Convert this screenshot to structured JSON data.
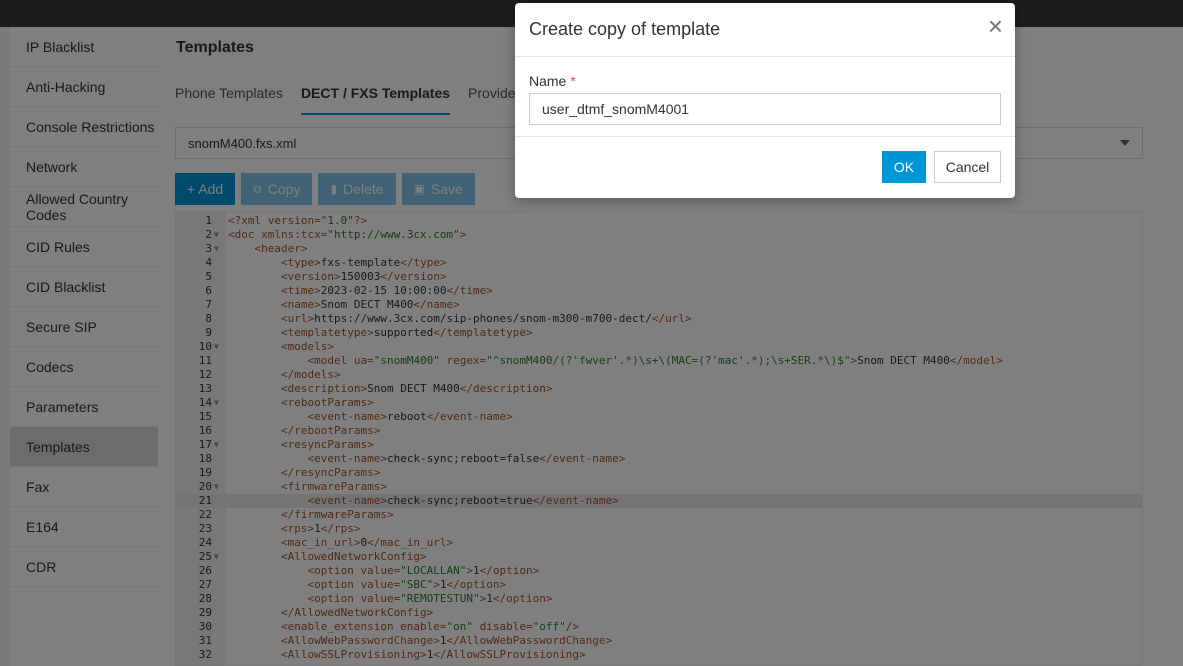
{
  "sidebar": {
    "items": [
      {
        "label": "IP Blacklist"
      },
      {
        "label": "Anti-Hacking"
      },
      {
        "label": "Console Restrictions"
      },
      {
        "label": "Network"
      },
      {
        "label": "Allowed Country Codes"
      },
      {
        "label": "CID Rules"
      },
      {
        "label": "CID Blacklist"
      },
      {
        "label": "Secure SIP"
      },
      {
        "label": "Codecs"
      },
      {
        "label": "Parameters"
      },
      {
        "label": "Templates"
      },
      {
        "label": "Fax"
      },
      {
        "label": "E164"
      },
      {
        "label": "CDR"
      }
    ]
  },
  "main": {
    "title": "Templates",
    "tabs": [
      "Phone Templates",
      "DECT / FXS Templates",
      "Provider T"
    ],
    "selected_template": "snomM400.fxs.xml",
    "toolbar": {
      "add": "+ Add",
      "copy": "Copy",
      "delete": "Delete",
      "save": "Save"
    }
  },
  "editor": {
    "lines": [
      {
        "n": "1",
        "c": "<?xml version=\"1.0\"?>"
      },
      {
        "n": "2",
        "c": "<doc xmlns:tcx=\"http://www.3cx.com\">"
      },
      {
        "n": "3",
        "c": "    <header>"
      },
      {
        "n": "4",
        "c": "        <type>fxs-template</type>"
      },
      {
        "n": "5",
        "c": "        <version>150003</version>"
      },
      {
        "n": "6",
        "c": "        <time>2023-02-15 10:00:00</time>"
      },
      {
        "n": "7",
        "c": "        <name>Snom DECT M400</name>"
      },
      {
        "n": "8",
        "c": "        <url>https://www.3cx.com/sip-phones/snom-m300-m700-dect/</url>"
      },
      {
        "n": "9",
        "c": "        <templatetype>supported</templatetype>"
      },
      {
        "n": "10",
        "c": "        <models>"
      },
      {
        "n": "11",
        "c": "            <model ua=\"snomM400\" regex=\"^snomM400/(?'fwver'.*)\\s+\\(MAC=(?'mac'.*);\\s+SER.*\\)$\">Snom DECT M400</model>"
      },
      {
        "n": "12",
        "c": "        </models>"
      },
      {
        "n": "13",
        "c": "        <description>Snom DECT M400</description>"
      },
      {
        "n": "14",
        "c": "        <rebootParams>"
      },
      {
        "n": "15",
        "c": "            <event-name>reboot</event-name>"
      },
      {
        "n": "16",
        "c": "        </rebootParams>"
      },
      {
        "n": "17",
        "c": "        <resyncParams>"
      },
      {
        "n": "18",
        "c": "            <event-name>check-sync;reboot=false</event-name>"
      },
      {
        "n": "19",
        "c": "        </resyncParams>"
      },
      {
        "n": "20",
        "c": "        <firmwareParams>"
      },
      {
        "n": "21",
        "c": "            <event-name>check-sync;reboot=true</event-name>"
      },
      {
        "n": "22",
        "c": "        </firmwareParams>"
      },
      {
        "n": "23",
        "c": "        <rps>1</rps>"
      },
      {
        "n": "24",
        "c": "        <mac_in_url>0</mac_in_url>"
      },
      {
        "n": "25",
        "c": "        <AllowedNetworkConfig>"
      },
      {
        "n": "26",
        "c": "            <option value=\"LOCALLAN\">1</option>"
      },
      {
        "n": "27",
        "c": "            <option value=\"SBC\">1</option>"
      },
      {
        "n": "28",
        "c": "            <option value=\"REMOTESTUN\">1</option>"
      },
      {
        "n": "29",
        "c": "        </AllowedNetworkConfig>"
      },
      {
        "n": "30",
        "c": "        <enable_extension enable=\"on\" disable=\"off\"/>"
      },
      {
        "n": "31",
        "c": "        <AllowWebPasswordChange>1</AllowWebPasswordChange>"
      },
      {
        "n": "32",
        "c": "        <AllowSSLProvisioning>1</AllowSSLProvisioning>"
      }
    ],
    "fold_lines": [
      "2",
      "3",
      "10",
      "14",
      "17",
      "20",
      "25"
    ],
    "highlight_line": "21"
  },
  "modal": {
    "title": "Create copy of template",
    "close_glyph": "×",
    "name_label": "Name",
    "required_mark": "*",
    "name_value": "user_dtmf_snomM4001",
    "ok_label": "OK",
    "cancel_label": "Cancel"
  },
  "colors": {
    "accent": "#0096d6",
    "accent_disabled": "#7fc7e8"
  }
}
